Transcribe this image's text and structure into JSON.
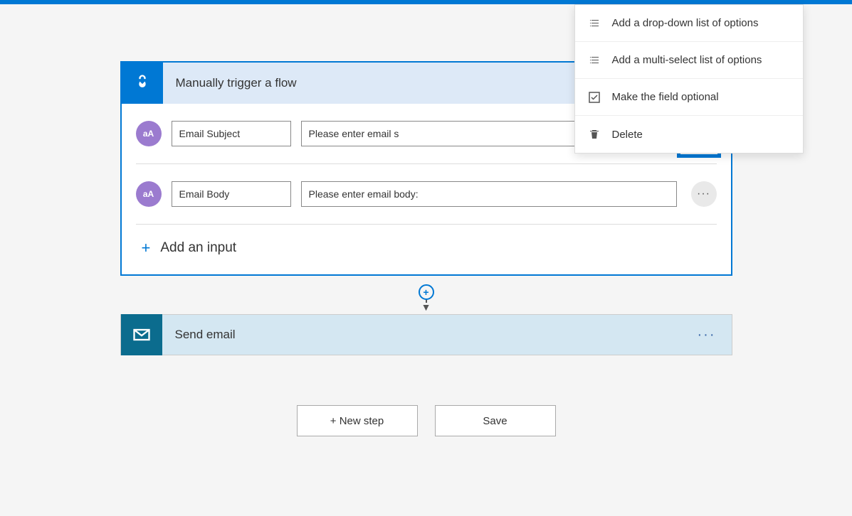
{
  "trigger": {
    "title": "Manually trigger a flow",
    "fields": [
      {
        "icon": "aA",
        "name": "Email Subject",
        "prompt": "Please enter email s"
      },
      {
        "icon": "aA",
        "name": "Email Body",
        "prompt": "Please enter email body:"
      }
    ],
    "add_input_label": "Add an input"
  },
  "context_menu": {
    "items": [
      {
        "label": "Add a drop-down list of options",
        "icon": "list"
      },
      {
        "label": "Add a multi-select list of options",
        "icon": "list"
      },
      {
        "label": "Make the field optional",
        "icon": "check"
      },
      {
        "label": "Delete",
        "icon": "trash"
      }
    ]
  },
  "action": {
    "title": "Send email"
  },
  "footer": {
    "new_step": "+ New step",
    "save": "Save"
  }
}
